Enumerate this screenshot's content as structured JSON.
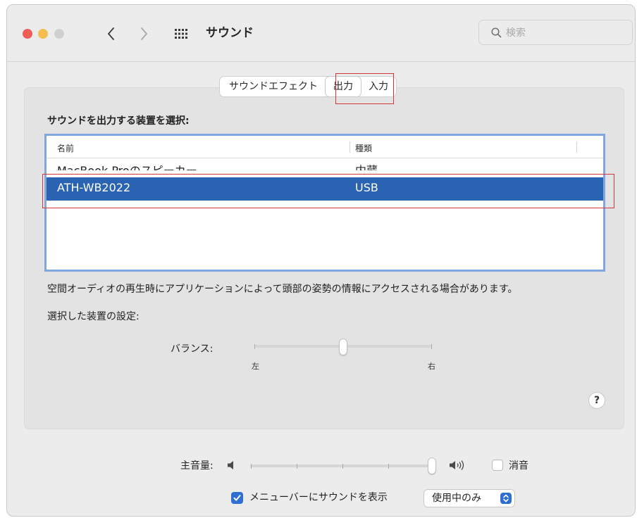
{
  "window": {
    "title": "サウンド"
  },
  "search": {
    "placeholder": "検索"
  },
  "tabs": [
    {
      "label": "サウンドエフェクト",
      "selected": false
    },
    {
      "label": "出力",
      "selected": true
    },
    {
      "label": "入力",
      "selected": false
    }
  ],
  "output": {
    "section_label": "サウンドを出力する装置を選択:",
    "columns": [
      "名前",
      "種類"
    ],
    "devices": [
      {
        "name": "MacBook Proのスピーカー",
        "type": "内蔵",
        "selected": false
      },
      {
        "name": "ATH-WB2022",
        "type": "USB",
        "selected": true
      }
    ],
    "info_text": "空間オーディオの再生時にアプリケーションによって頭部の姿勢の情報にアクセスされる場合があります。",
    "settings_label": "選択した装置の設定:",
    "balance": {
      "label": "バランス:",
      "left_label": "左",
      "right_label": "右",
      "value": 0.5
    },
    "help_label": "?"
  },
  "volume": {
    "label": "主音量:",
    "value": 1.0,
    "mute_label": "消音",
    "muted": false
  },
  "menubar": {
    "checked": true,
    "label": "メニューバーにサウンドを表示",
    "option": "使用中のみ"
  },
  "colors": {
    "selection": "#2a63b2",
    "annotation_highlight": "#d0383c",
    "accent": "#2f6fd1"
  }
}
